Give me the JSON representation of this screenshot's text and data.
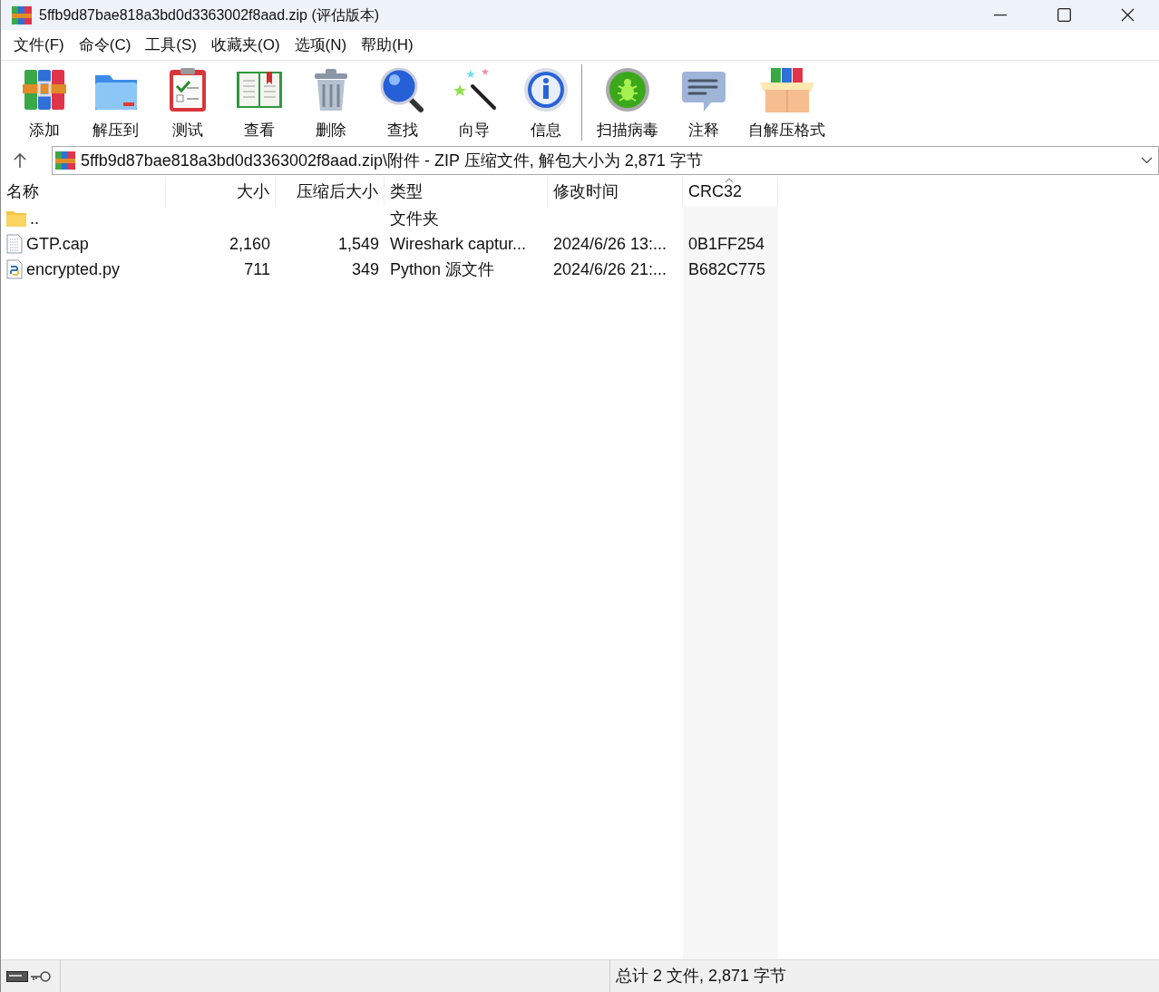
{
  "window": {
    "title": "5ffb9d87bae818a3bd0d3363002f8aad.zip (评估版本)"
  },
  "menu": [
    "文件(F)",
    "命令(C)",
    "工具(S)",
    "收藏夹(O)",
    "选项(N)",
    "帮助(H)"
  ],
  "toolbar": {
    "groups": [
      [
        {
          "label": "添加",
          "kind": "add"
        },
        {
          "label": "解压到",
          "kind": "extract"
        },
        {
          "label": "测试",
          "kind": "test"
        },
        {
          "label": "查看",
          "kind": "view"
        },
        {
          "label": "删除",
          "kind": "delete"
        },
        {
          "label": "查找",
          "kind": "find"
        },
        {
          "label": "向导",
          "kind": "wizard"
        },
        {
          "label": "信息",
          "kind": "info"
        }
      ],
      [
        {
          "label": "扫描病毒",
          "kind": "scan"
        },
        {
          "label": "注释",
          "kind": "comment"
        },
        {
          "label": "自解压格式",
          "kind": "sfx"
        }
      ]
    ]
  },
  "address": {
    "path": "5ffb9d87bae818a3bd0d3363002f8aad.zip\\附件 - ZIP 压缩文件, 解包大小为 2,871 字节"
  },
  "table": {
    "columns": [
      {
        "label": "名称",
        "kind": "text",
        "sorted": false
      },
      {
        "label": "大小",
        "kind": "number",
        "sorted": false
      },
      {
        "label": "压缩后大小",
        "kind": "number",
        "sorted": false
      },
      {
        "label": "类型",
        "kind": "text",
        "sorted": false
      },
      {
        "label": "修改时间",
        "kind": "text",
        "sorted": false
      },
      {
        "label": "CRC32",
        "kind": "text",
        "sorted": true
      }
    ],
    "rows": [
      {
        "kind": "folder",
        "cells": [
          "..",
          "",
          "",
          "文件夹",
          "",
          ""
        ]
      },
      {
        "kind": "capture",
        "cells": [
          "GTP.cap",
          "2,160",
          "1,549",
          "Wireshark captur...",
          "2024/6/26 13:...",
          "0B1FF254"
        ]
      },
      {
        "kind": "python",
        "cells": [
          "encrypted.py",
          "711",
          "349",
          "Python 源文件",
          "2024/6/26 21:...",
          "B682C775"
        ]
      }
    ]
  },
  "status_bar": {
    "text": "总计 2 文件, 2,871 字节"
  }
}
